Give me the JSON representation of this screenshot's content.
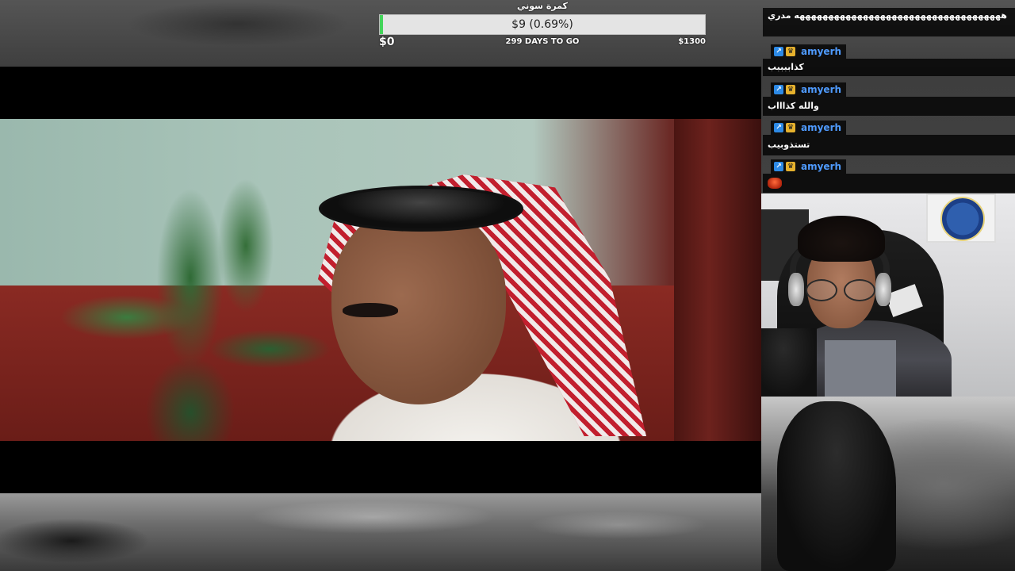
{
  "goal": {
    "title": "كمرة سوني",
    "amount_text": "$9 (0.69%)",
    "progress_fraction": 0.0069,
    "start_label": "$0",
    "days_label": "299 DAYS TO GO",
    "target_label": "$1300",
    "fill_color": "#43d45a"
  },
  "chat": {
    "messages": [
      {
        "type": "text",
        "text": "ههههههههههههههههههههههههههههههههههههه مدري"
      },
      {
        "type": "user",
        "username": "amyerh",
        "badges": [
          "prime-badge-icon",
          "crown-badge-icon"
        ]
      },
      {
        "type": "text",
        "text": "كذاببببب"
      },
      {
        "type": "user",
        "username": "amyerh",
        "badges": [
          "prime-badge-icon",
          "crown-badge-icon"
        ]
      },
      {
        "type": "text",
        "text": "والله كذاااب"
      },
      {
        "type": "user",
        "username": "amyerh",
        "badges": [
          "prime-badge-icon",
          "crown-badge-icon"
        ]
      },
      {
        "type": "text",
        "text": "تستذوبيب"
      },
      {
        "type": "user",
        "username": "amyerh",
        "badges": [
          "prime-badge-icon",
          "crown-badge-icon"
        ]
      },
      {
        "type": "emote",
        "emote": "fire-emote-icon"
      }
    ],
    "username_color": "#4f9bff"
  }
}
